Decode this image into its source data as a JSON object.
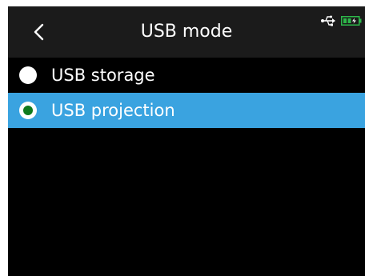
{
  "header": {
    "title": "USB mode",
    "back_icon": "chevron-left-icon"
  },
  "status_bar": {
    "usb_icon": "usb-icon",
    "battery_icon": "battery-charging-icon",
    "battery_color": "#2db84a"
  },
  "menu": {
    "items": [
      {
        "label": "USB storage",
        "selected": false
      },
      {
        "label": "USB projection",
        "selected": true
      }
    ]
  },
  "colors": {
    "background": "#000000",
    "header": "#1b1b1b",
    "selection": "#3aa3e0",
    "radio_selected_dot": "#0f7a1e"
  }
}
